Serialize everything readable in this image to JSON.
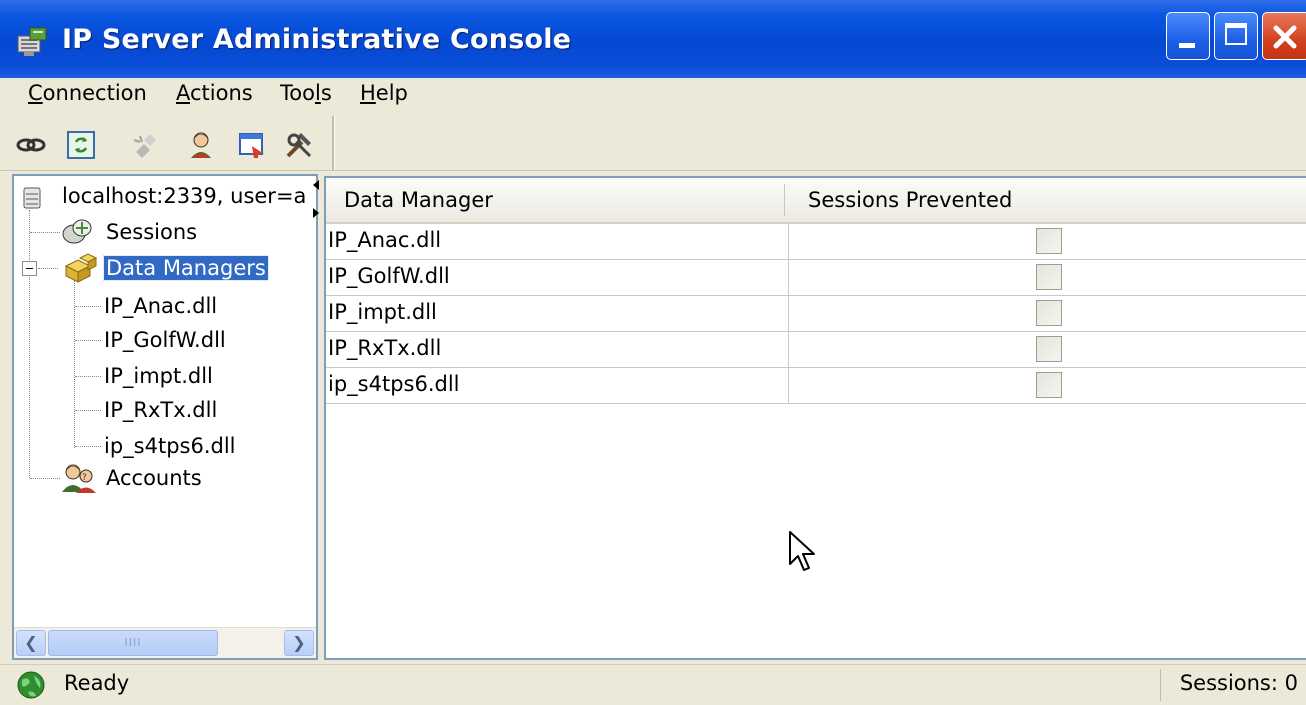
{
  "window": {
    "title": "IP Server Administrative Console",
    "colors": {
      "title_bar": "#0548d2",
      "selection": "#316ac5",
      "chrome": "#ece9d8",
      "close_button": "#d2421e"
    }
  },
  "menu": {
    "connection": {
      "accel": "C",
      "rest": "onnection"
    },
    "actions": {
      "accel": "A",
      "rest": "ctions"
    },
    "tools": {
      "pre": "Too",
      "accel": "l",
      "rest": "s"
    },
    "help": {
      "accel": "H",
      "rest": "elp"
    }
  },
  "toolbar": {
    "icons": [
      "connect-icon",
      "refresh-icon",
      "disconnect-icon",
      "user-icon",
      "export-icon",
      "tools-icon"
    ]
  },
  "tree": {
    "root": "localhost:2339, user=a",
    "nodes": [
      {
        "label": "Sessions",
        "icon": "sessions-icon"
      },
      {
        "label": "Data Managers",
        "icon": "data-managers-icon",
        "selected": true,
        "expanded": true
      },
      {
        "label": "IP_Anac.dll"
      },
      {
        "label": "IP_GolfW.dll"
      },
      {
        "label": "IP_impt.dll"
      },
      {
        "label": "IP_RxTx.dll"
      },
      {
        "label": "ip_s4tps6.dll"
      },
      {
        "label": "Accounts",
        "icon": "accounts-icon"
      }
    ],
    "scrollbar_thumb_grip": "IIII"
  },
  "list": {
    "columns": [
      "Data Manager",
      "Sessions Prevented"
    ],
    "rows": [
      {
        "name": "IP_Anac.dll",
        "sessions_prevented": false
      },
      {
        "name": "IP_GolfW.dll",
        "sessions_prevented": false
      },
      {
        "name": "IP_impt.dll",
        "sessions_prevented": false
      },
      {
        "name": "IP_RxTx.dll",
        "sessions_prevented": false
      },
      {
        "name": "ip_s4tps6.dll",
        "sessions_prevented": false
      }
    ]
  },
  "status": {
    "text": "Ready",
    "sessions": "Sessions: 0"
  }
}
